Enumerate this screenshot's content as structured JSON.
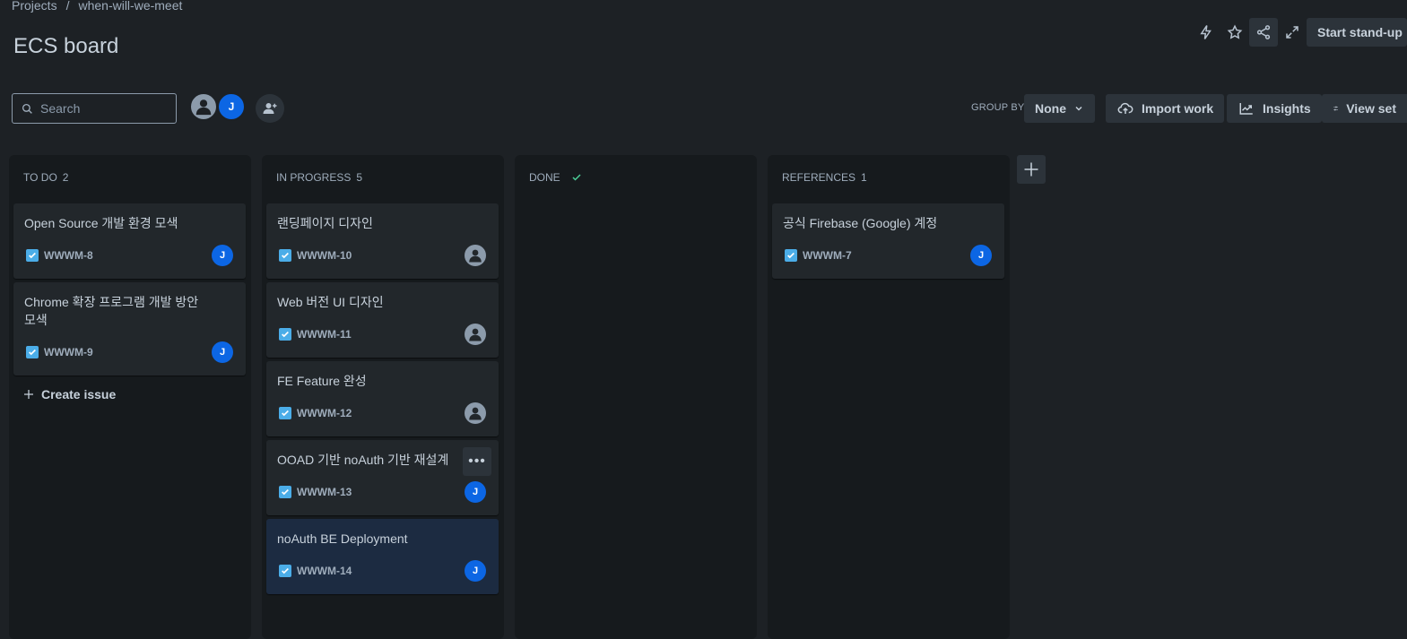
{
  "breadcrumb": {
    "projects": "Projects",
    "separator": "/",
    "project": "when-will-we-meet"
  },
  "page_title": "ECS board",
  "header_actions": {
    "start_standup": "Start stand-up"
  },
  "search": {
    "placeholder": "Search",
    "value": ""
  },
  "avatars": [
    {
      "initial": "",
      "icon": "person-icon"
    },
    {
      "initial": "J"
    }
  ],
  "toolbar": {
    "group_by_label": "GROUP BY",
    "group_by_value": "None",
    "import_work": "Import work",
    "insights": "Insights",
    "view_settings": "View set"
  },
  "columns": [
    {
      "title": "TO DO",
      "count": "2",
      "cards": [
        {
          "title": "Open Source 개발 환경 모색",
          "key": "WWWM-8",
          "assignee": "J"
        },
        {
          "title": "Chrome 확장 프로그램 개발 방안 모색",
          "key": "WWWM-9",
          "assignee": "J"
        }
      ],
      "create_issue": "Create issue"
    },
    {
      "title": "IN PROGRESS",
      "count": "5",
      "cards": [
        {
          "title": "랜딩페이지 디자인",
          "key": "WWWM-10",
          "assignee": ""
        },
        {
          "title": "Web 버전 UI 디자인",
          "key": "WWWM-11",
          "assignee": ""
        },
        {
          "title": "FE Feature 완성",
          "key": "WWWM-12",
          "assignee": ""
        },
        {
          "title": "OOAD 기반 noAuth 기반 재설계",
          "key": "WWWM-13",
          "assignee": "J"
        },
        {
          "title": "noAuth BE Deployment",
          "key": "WWWM-14",
          "assignee": "J"
        }
      ]
    },
    {
      "title": "DONE",
      "count": "",
      "cards": []
    },
    {
      "title": "REFERENCES",
      "count": "1",
      "cards": [
        {
          "title": "공식 Firebase (Google) 계정",
          "key": "WWWM-7",
          "assignee": "J"
        }
      ]
    }
  ],
  "colors": {
    "background": "#1d2125",
    "column": "#161a1d",
    "card": "#22272b",
    "accent": "#0c66e4",
    "checkbox": "#4bade8",
    "done_check": "#4bce97"
  }
}
